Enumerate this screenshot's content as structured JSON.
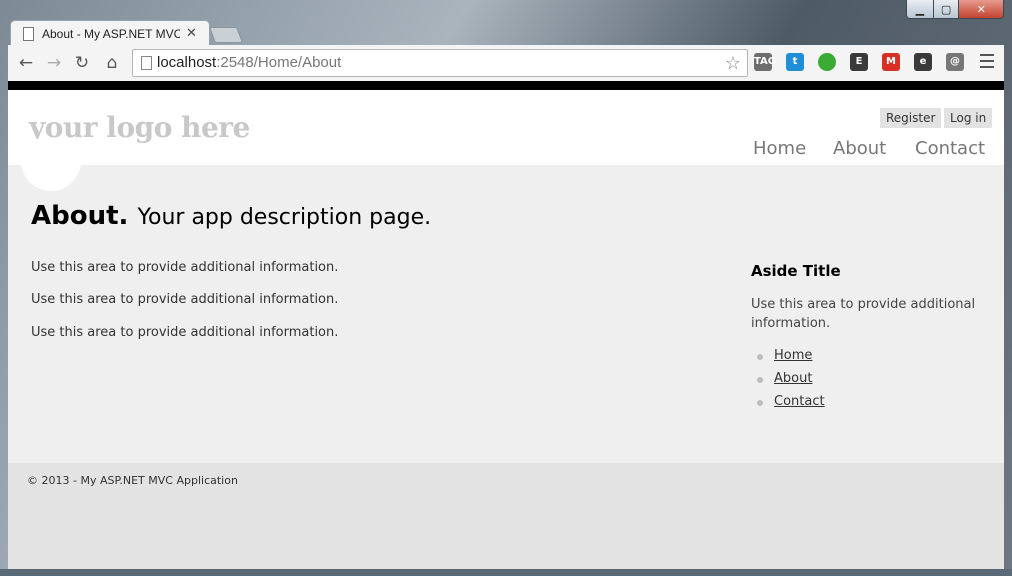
{
  "browser": {
    "tab_title": "About - My ASP.NET MVC",
    "url_host": "localhost",
    "url_rest": ":2548/Home/About",
    "extensions": [
      {
        "name": "tag-extension-icon",
        "color": "#6d6d6d",
        "glyph": "TAG"
      },
      {
        "name": "twitter-icon",
        "color": "#1e8fd6",
        "glyph": "t"
      },
      {
        "name": "leaf-icon",
        "color": "#3aaa35",
        "glyph": ""
      },
      {
        "name": "grid-extension-icon",
        "color": "#3a3a3a",
        "glyph": "E"
      },
      {
        "name": "gmail-icon",
        "color": "#d93025",
        "glyph": "M"
      },
      {
        "name": "evernote-icon",
        "color": "#3a3a3a",
        "glyph": "e"
      },
      {
        "name": "at-sign-icon",
        "color": "#777777",
        "glyph": "@"
      }
    ]
  },
  "site": {
    "logo": "your logo here",
    "register": "Register",
    "login": "Log in",
    "nav": {
      "home": "Home",
      "about": "About",
      "contact": "Contact"
    },
    "title_main": "About.",
    "title_sub": "Your app description page.",
    "paragraphs": [
      "Use this area to provide additional information.",
      "Use this area to provide additional information.",
      "Use this area to provide additional information."
    ],
    "aside_title": "Aside Title",
    "aside_text": "Use this area to provide additional information.",
    "aside_links": [
      "Home",
      "About",
      "Contact"
    ],
    "footer": "© 2013 - My ASP.NET MVC Application"
  }
}
